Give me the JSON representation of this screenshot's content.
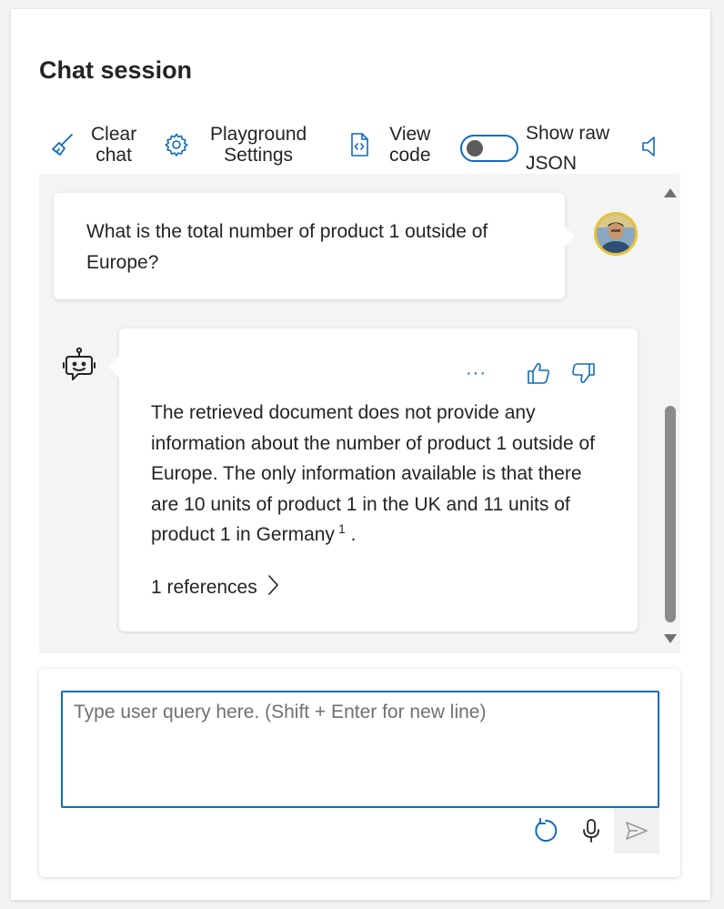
{
  "header": {
    "title": "Chat session"
  },
  "toolbar": {
    "clear_label": "Clear chat",
    "clear_line1": "Clear",
    "clear_line2": "chat",
    "settings_line1": "Playground",
    "settings_line2": "Settings",
    "viewcode_line1": "View",
    "viewcode_line2": "code",
    "raw_line1": "Show raw",
    "raw_line2": "JSON",
    "raw_toggle_on": false
  },
  "conversation": {
    "user_message": "What is the total number of product 1 outside of Europe?",
    "assistant_message": "The retrieved document does not provide any information about the number of product 1 outside of Europe. The only information available is that there are 10 units of product 1 in the UK and 11 units of product 1 in Germany",
    "assistant_citation": "1",
    "assistant_tail": ".",
    "more_label": "···",
    "references_label": "1 references"
  },
  "input": {
    "placeholder": "Type user query here. (Shift + Enter for new line)",
    "value": ""
  },
  "colors": {
    "accent": "#0f6cbd",
    "chat_bg": "#f4f4f4",
    "avatar_ring": "#e8c33a"
  }
}
